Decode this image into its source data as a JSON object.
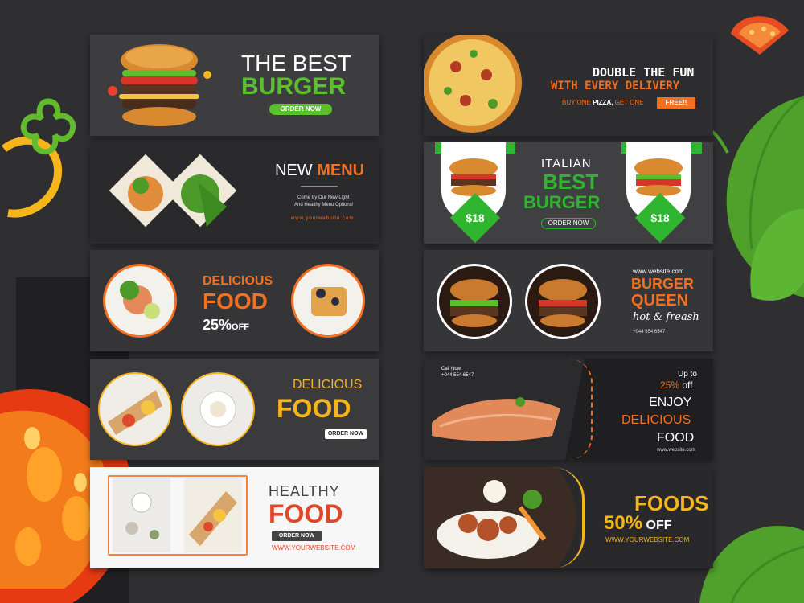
{
  "colors": {
    "background": "#2f2f31",
    "green": "#5bbf2e",
    "orange": "#f36f21",
    "yellow": "#f5b51b",
    "red": "#e0482b"
  },
  "banners": {
    "burger_best": {
      "line1": "THE BEST",
      "line2": "BURGER",
      "cta": "ORDER NOW"
    },
    "new_menu": {
      "word1": "NEW",
      "word2": "MENU",
      "desc1": "Come try Our New Light",
      "desc2": "And Healthy Menu Options!",
      "url": "www.yourwebsite.com"
    },
    "delicious_discount": {
      "line1": "DELICIOUS",
      "line2": "FOOD",
      "percent": "25%",
      "off": "OFF"
    },
    "delicious_yellow": {
      "line1": "DELICIOUS",
      "line2": "FOOD",
      "cta": "ORDER NOW"
    },
    "healthy": {
      "line1": "HEALTHY",
      "line2": "FOOD",
      "cta": "ORDER NOW",
      "url": "WWW.YOURWEBSITE.COM"
    },
    "pizza": {
      "line1": "DOUBLE THE FUN",
      "line2": "WITH EVERY DELIVERY",
      "offer_pre": "BUY ONE",
      "offer_item": "PIZZA,",
      "offer_post": "GET ONE",
      "free": "FREE!!"
    },
    "italian": {
      "line1": "ITALIAN",
      "line2": "BEST",
      "line3": "BURGER",
      "cta": "ORDER NOW",
      "price_left": "$18",
      "price_right": "$18"
    },
    "queen": {
      "url": "www.website.com",
      "line1": "BURGER",
      "line2": "QUEEN",
      "tagline": "hot & freash",
      "phone": "+044 554 6547"
    },
    "salmon": {
      "call_label": "Call Now",
      "phone": "+044 554 6547",
      "upto": "Up to",
      "percent": "25%",
      "off": "off",
      "line1": "ENJOY",
      "line2": "DELICIOUS",
      "line3": "FOOD",
      "url": "www.website.com"
    },
    "foods": {
      "word": "FOODS",
      "percent": "50%",
      "off": "OFF",
      "url": "WWW.YOURWEBSITE.COM"
    }
  }
}
